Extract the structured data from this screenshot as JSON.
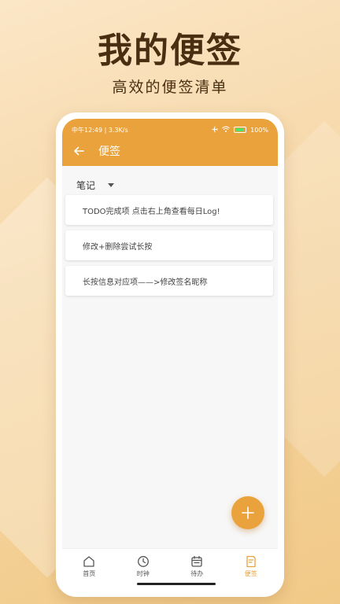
{
  "promo": {
    "title": "我的便签",
    "subtitle": "高效的便签清单"
  },
  "status_bar": {
    "left": "中午12:49 | 3.3K/s",
    "battery": "100%"
  },
  "toolbar": {
    "title": "便签",
    "back_icon": "arrow-left-icon"
  },
  "category": {
    "selected": "笔记"
  },
  "notes": [
    {
      "text": "TODO完成项 点击右上角查看每日Log!"
    },
    {
      "text": "修改+删除尝试长按"
    },
    {
      "text": "长按信息对应项——>修改签名昵称"
    }
  ],
  "fab": {
    "icon": "plus-icon"
  },
  "bottom_nav": [
    {
      "label": "首页",
      "icon": "home-icon",
      "active": false
    },
    {
      "label": "时钟",
      "icon": "clock-icon",
      "active": false
    },
    {
      "label": "待办",
      "icon": "calendar-icon",
      "active": false
    },
    {
      "label": "便签",
      "icon": "note-icon",
      "active": true
    }
  ],
  "colors": {
    "accent": "#eaa23c",
    "title_text": "#4a2e12"
  }
}
